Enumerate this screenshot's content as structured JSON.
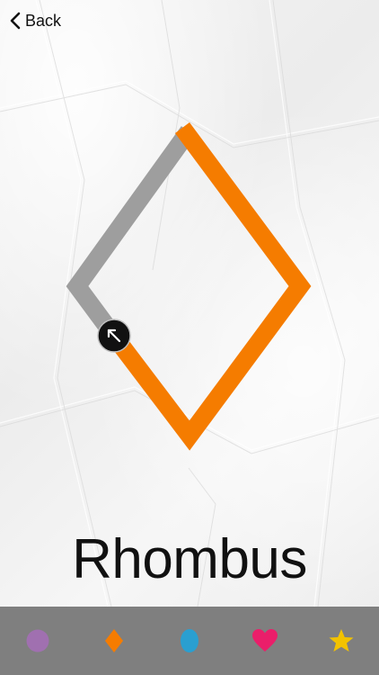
{
  "nav": {
    "back_label": "Back"
  },
  "shape": {
    "name": "Rhombus",
    "traced_color": "#f57c00",
    "untraced_color": "#9e9e9e",
    "cursor_color": "#111111"
  },
  "bottom_bar": {
    "background": "#7f7f7f",
    "items": [
      {
        "icon": "circle-icon",
        "color": "#a070b0"
      },
      {
        "icon": "diamond-icon",
        "color": "#f57c00"
      },
      {
        "icon": "oval-icon",
        "color": "#2a9fd0"
      },
      {
        "icon": "heart-icon",
        "color": "#ea1e6a"
      },
      {
        "icon": "star-icon",
        "color": "#f2c200"
      }
    ]
  }
}
